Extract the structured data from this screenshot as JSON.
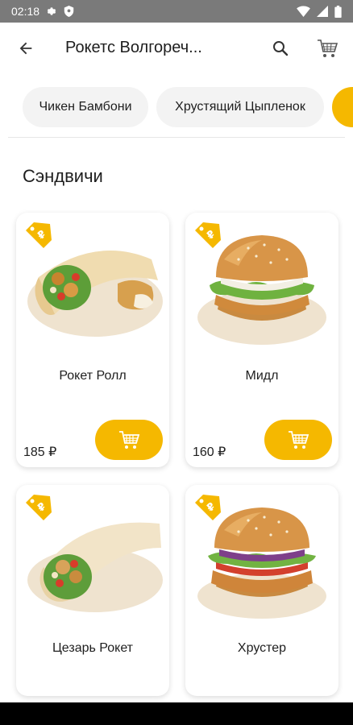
{
  "status": {
    "time": "02:18"
  },
  "header": {
    "title": "Рокетс Волгореч..."
  },
  "chips": [
    {
      "label": "Чикен Бамбони"
    },
    {
      "label": "Хрустящий Цыпленок"
    }
  ],
  "section": {
    "title": "Сэндвичи"
  },
  "products": [
    {
      "name": "Рокет Ролл",
      "price": "185 ₽"
    },
    {
      "name": "Мидл",
      "price": "160 ₽"
    },
    {
      "name": "Цезарь Рокет"
    },
    {
      "name": "Хрустер"
    }
  ],
  "colors": {
    "accent": "#f5b800",
    "chip_bg": "#f3f3f3",
    "status_bar": "#7a7a7a"
  }
}
